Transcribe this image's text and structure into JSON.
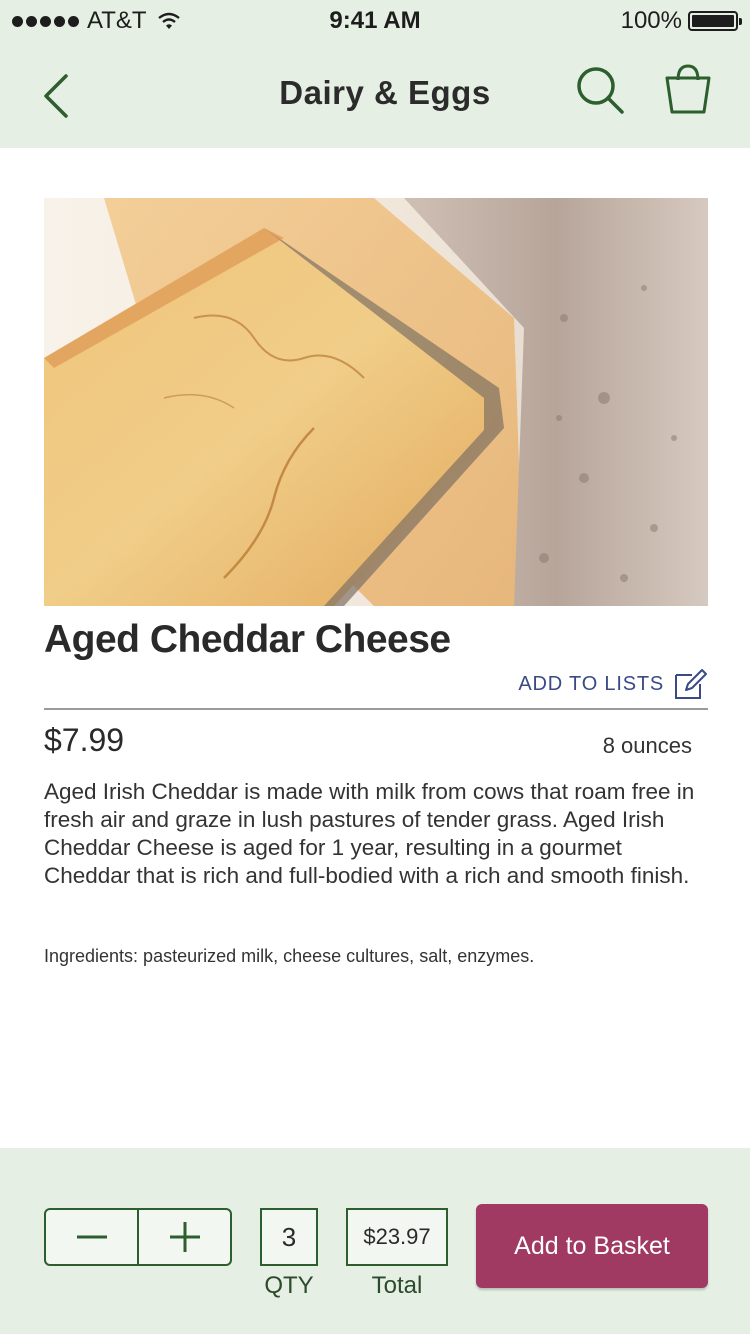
{
  "status_bar": {
    "carrier": "AT&T",
    "time": "9:41 AM",
    "battery": "100%"
  },
  "nav": {
    "title": "Dairy & Eggs",
    "back_icon": "chevron-left-icon",
    "search_icon": "search-icon",
    "basket_icon": "shopping-bag-icon"
  },
  "product": {
    "name": "Aged Cheddar Cheese",
    "add_to_lists": "ADD TO LISTS",
    "price": "$7.99",
    "size": "8 ounces",
    "description": "Aged Irish Cheddar is made with milk from cows that roam free in fresh air and graze in lush pastures of tender grass. Aged Irish Cheddar Cheese is aged for 1 year, resulting in a gourmet Cheddar that is rich and full-bodied with a rich and smooth finish.",
    "ingredients": "Ingredients: pasteurized milk, cheese cultures, salt, enzymes."
  },
  "cart": {
    "quantity": "3",
    "quantity_label": "QTY",
    "total": "$23.97",
    "total_label": "Total",
    "add_button": "Add to Basket"
  },
  "colors": {
    "header_bg": "#e5efe3",
    "accent_green": "#2c5e2e",
    "button_bg": "#a03a62",
    "link_blue": "#3b4a86"
  }
}
